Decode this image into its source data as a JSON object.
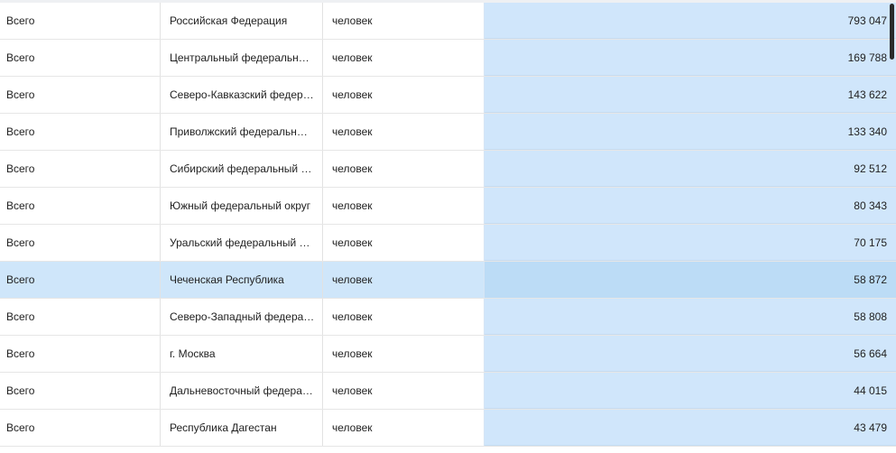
{
  "table": {
    "rows": [
      {
        "category": "Всего",
        "region": "Российская Федерация",
        "unit": "человек",
        "value": "793 047",
        "selected": false
      },
      {
        "category": "Всего",
        "region": "Центральный федеральный…",
        "unit": "человек",
        "value": "169 788",
        "selected": false
      },
      {
        "category": "Всего",
        "region": "Северо-Кавказский федера…",
        "unit": "человек",
        "value": "143 622",
        "selected": false
      },
      {
        "category": "Всего",
        "region": "Приволжский федеральный…",
        "unit": "человек",
        "value": "133 340",
        "selected": false
      },
      {
        "category": "Всего",
        "region": "Сибирский федеральный ок…",
        "unit": "человек",
        "value": "92 512",
        "selected": false
      },
      {
        "category": "Всего",
        "region": "Южный федеральный округ",
        "unit": "человек",
        "value": "80 343",
        "selected": false
      },
      {
        "category": "Всего",
        "region": "Уральский федеральный ок…",
        "unit": "человек",
        "value": "70 175",
        "selected": false
      },
      {
        "category": "Всего",
        "region": "Чеченская Республика",
        "unit": "человек",
        "value": "58 872",
        "selected": true
      },
      {
        "category": "Всего",
        "region": "Северо-Западный федерал…",
        "unit": "человек",
        "value": "58 808",
        "selected": false
      },
      {
        "category": "Всего",
        "region": "г. Москва",
        "unit": "человек",
        "value": "56 664",
        "selected": false
      },
      {
        "category": "Всего",
        "region": "Дальневосточный федерал…",
        "unit": "человек",
        "value": "44 015",
        "selected": false
      },
      {
        "category": "Всего",
        "region": "Республика Дагестан",
        "unit": "человек",
        "value": "43 479",
        "selected": false
      }
    ]
  },
  "colors": {
    "value_column_bg": "#d0e6fb",
    "selected_row_bg": "#cfe6fa"
  }
}
